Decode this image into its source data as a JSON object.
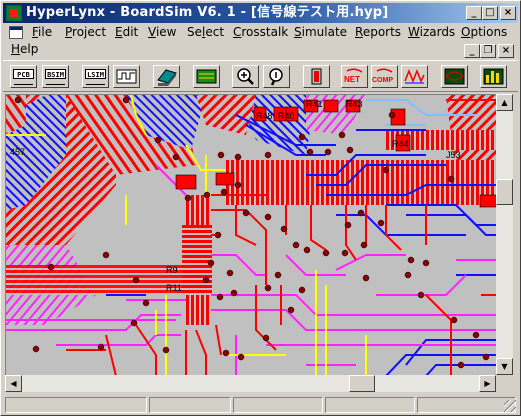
{
  "window": {
    "title": "HyperLynx - BoardSim V6. 1 - [信号線テスト用.hyp]",
    "minimize_glyph": "_",
    "maximize_glyph": "□",
    "close_glyph": "×"
  },
  "menu": {
    "items": [
      {
        "key": "F",
        "rest": "ile"
      },
      {
        "key": "P",
        "rest": "roject"
      },
      {
        "key": "E",
        "rest": "dit"
      },
      {
        "key": "V",
        "rest": "iew"
      },
      {
        "pre": "Se",
        "key": "l",
        "rest": "ect"
      },
      {
        "key": "C",
        "rest": "rosstalk"
      },
      {
        "key": "S",
        "rest": "imulate"
      },
      {
        "key": "R",
        "rest": "eports"
      },
      {
        "key": "W",
        "rest": "izards"
      },
      {
        "key": "O",
        "rest": "ptions"
      }
    ],
    "help": {
      "key": "H",
      "rest": "elp"
    },
    "mdi_minimize_glyph": "_",
    "mdi_restore_glyph": "❐",
    "mdi_close_glyph": "×"
  },
  "toolbar": {
    "buttons": [
      {
        "label": "PCB",
        "icon": "pcb-icon"
      },
      {
        "label": "BSIM",
        "icon": "bsim-icon"
      },
      {
        "label": "LSIM",
        "icon": "lsim-icon"
      },
      {
        "label": "",
        "icon": "waveform-icon"
      },
      {
        "label": "",
        "icon": "layer-stack-icon"
      },
      {
        "label": "",
        "icon": "board-green-icon"
      },
      {
        "label": "",
        "icon": "zoom-in-icon"
      },
      {
        "label": "",
        "icon": "zoom-out-icon"
      },
      {
        "label": "",
        "icon": "terminator-icon"
      },
      {
        "label": "NET",
        "icon": "net-icon"
      },
      {
        "label": "COMP",
        "icon": "comp-icon"
      },
      {
        "label": "",
        "icon": "signal-icon"
      },
      {
        "label": "",
        "icon": "eye-diagram-icon"
      },
      {
        "label": "",
        "icon": "bar-chart-icon"
      }
    ]
  },
  "board": {
    "refdes": [
      "R48",
      "R40",
      "R41",
      "R43",
      "R9",
      "R11",
      "R44",
      "J53",
      "457"
    ]
  },
  "colors": {
    "trace_red": "#ff0000",
    "trace_blue": "#1010ff",
    "trace_magenta": "#ff22ff",
    "trace_yellow": "#ffff00",
    "board": "#c0c0c0",
    "via": "#8b0000"
  }
}
